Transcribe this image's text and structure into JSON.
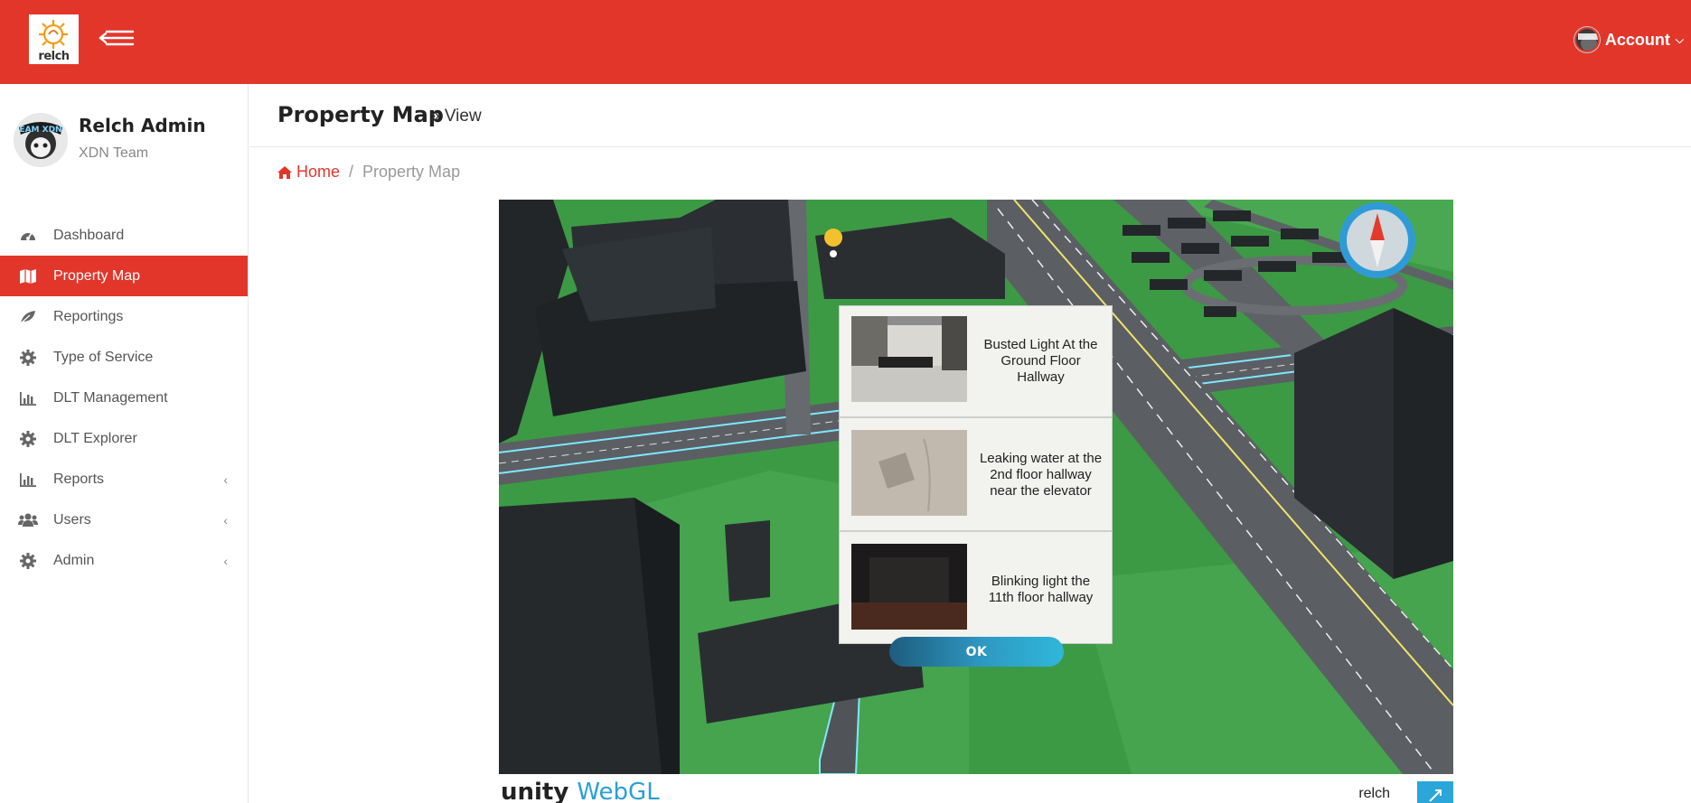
{
  "app": {
    "logo_text": "relch",
    "account_label": "Account"
  },
  "colors": {
    "brand": "#e3362a",
    "ok_button": "#2e9ac4"
  },
  "sidebar": {
    "profile": {
      "name": "Relch Admin",
      "team": "XDN Team"
    },
    "items": [
      {
        "label": "Dashboard",
        "icon": "dashboard-icon",
        "active": false,
        "has_submenu": false
      },
      {
        "label": "Property Map",
        "icon": "map-icon",
        "active": true,
        "has_submenu": false
      },
      {
        "label": "Reportings",
        "icon": "leaf-icon",
        "active": false,
        "has_submenu": false
      },
      {
        "label": "Type of Service",
        "icon": "gear-icon",
        "active": false,
        "has_submenu": false
      },
      {
        "label": "DLT Management",
        "icon": "bar-chart-icon",
        "active": false,
        "has_submenu": false
      },
      {
        "label": "DLT Explorer",
        "icon": "gear-icon",
        "active": false,
        "has_submenu": false
      },
      {
        "label": "Reports",
        "icon": "bar-chart-icon",
        "active": false,
        "has_submenu": true
      },
      {
        "label": "Users",
        "icon": "users-icon",
        "active": false,
        "has_submenu": true
      },
      {
        "label": "Admin",
        "icon": "gear-icon",
        "active": false,
        "has_submenu": true
      }
    ]
  },
  "page": {
    "title": "Property Map",
    "subtitle": "» View"
  },
  "breadcrumb": {
    "home": "Home",
    "separator": "/",
    "current": "Property Map"
  },
  "popup": {
    "issues": [
      {
        "text": "Busted Light At the Ground Floor Hallway",
        "thumb": "lobby-photo"
      },
      {
        "text": "Leaking water at the 2nd floor hallway near the elevator",
        "thumb": "wall-photo"
      },
      {
        "text": "Blinking light the 11th floor hallway",
        "thumb": "dark-room-photo"
      }
    ],
    "ok_label": "OK"
  },
  "unity": {
    "logo_unity": "unity",
    "logo_webgl": "WebGL",
    "title": "relch"
  }
}
